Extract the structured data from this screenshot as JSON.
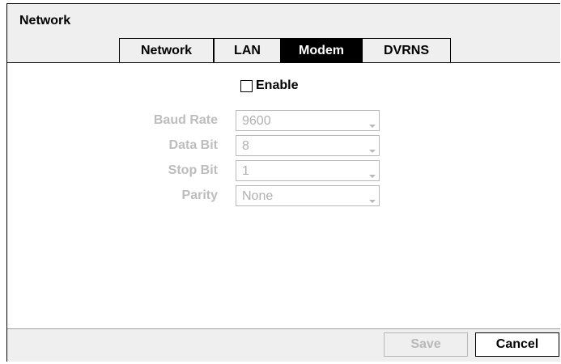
{
  "window": {
    "title": "Network"
  },
  "tabs": [
    {
      "label": "Network",
      "active": false
    },
    {
      "label": "LAN",
      "active": false
    },
    {
      "label": "Modem",
      "active": true
    },
    {
      "label": "DVRNS",
      "active": false
    }
  ],
  "modem": {
    "enable_label": "Enable",
    "enable_checked": false,
    "fields": [
      {
        "label": "Baud Rate",
        "value": "9600"
      },
      {
        "label": "Data Bit",
        "value": "8"
      },
      {
        "label": "Stop Bit",
        "value": "1"
      },
      {
        "label": "Parity",
        "value": "None"
      }
    ]
  },
  "buttons": {
    "save": "Save",
    "cancel": "Cancel"
  },
  "colors": {
    "active_tab_bg": "#000000",
    "disabled_text": "#b8b8b8",
    "panel_bg": "#efefef"
  }
}
